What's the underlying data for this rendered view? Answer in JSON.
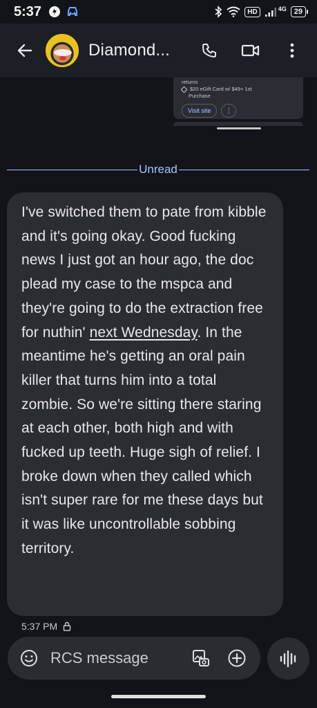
{
  "status_bar": {
    "time": "5:37",
    "network_badge": "HD",
    "network_type": "4G",
    "battery": "29",
    "icons": [
      "app-notification-icon",
      "car-icon",
      "bluetooth-icon",
      "wifi-icon",
      "signal-icon"
    ]
  },
  "app_bar": {
    "contact_name": "Diamond...",
    "icons": [
      "back-arrow-icon",
      "phone-icon",
      "video-call-icon",
      "more-vert-icon"
    ]
  },
  "link_preview": {
    "line1": "returns",
    "offer": "$20 eGift Card w/ $49+ 1st",
    "offer_line2": "Purchase",
    "visit_label": "Visit site",
    "more_label": "⋮"
  },
  "divider": {
    "label": "Unread"
  },
  "message": {
    "text_before_link": "I've switched them to pate from kibble and it's going okay. Good fucking news I just got an hour ago, the doc plead my case to the mspca and they're going to do the extraction free for nuthin' ",
    "link_text": "next Wednesday",
    "text_after_link": ". In the meantime he's getting an oral pain killer that turns him into a total zombie. So we're sitting there staring at each other, both high and with fucked up teeth. Huge sigh of relief. I broke down when they called which isn't super rare for me these days but it was like uncontrollable sobbing territory.",
    "timestamp": "5:37 PM"
  },
  "composer": {
    "placeholder": "RCS message",
    "icons": [
      "emoji-icon",
      "gallery-icon",
      "add-icon",
      "voice-icon"
    ]
  },
  "colors": {
    "background": "#12141a",
    "app_bar": "#1c1f26",
    "bubble": "#2b2d32",
    "accent": "#a9c2ff"
  }
}
